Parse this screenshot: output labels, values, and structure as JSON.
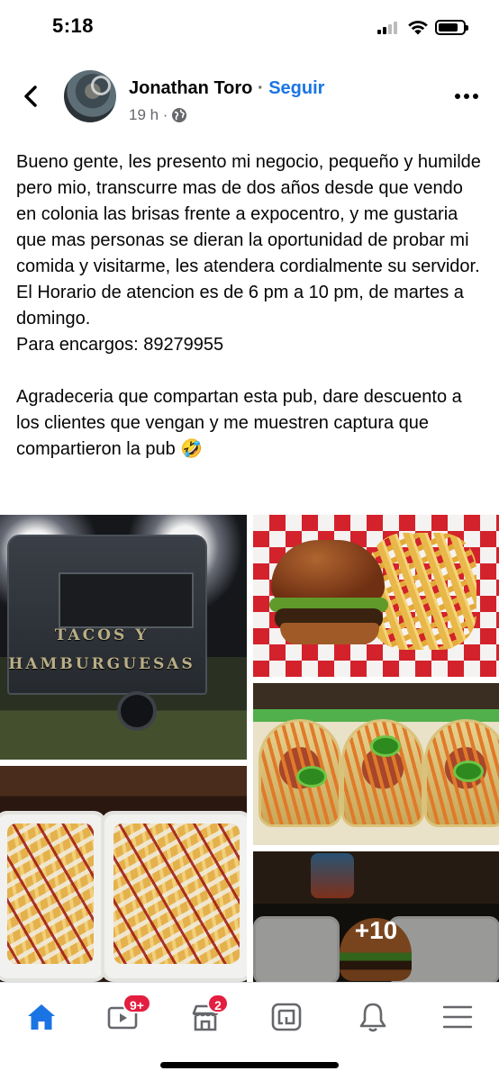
{
  "status_bar": {
    "time": "5:18"
  },
  "post": {
    "author": "Jonathan Toro",
    "separator": "·",
    "follow_label": "Seguir",
    "time_ago": "19 h ·",
    "privacy_icon": "globe-icon",
    "paragraphs": [
      "Bueno gente, les presento mi negocio, pequeño y humilde pero mio, transcurre mas de dos años desde que vendo en colonia las brisas frente a expocentro, y me gustaria que mas personas se dieran la oportunidad de probar mi comida y visitarme, les atendera cordialmente su servidor.\nEl Horario de atencion es de 6 pm a 10 pm, de martes a domingo.\nPara encargos: 89279955",
      "Agradeceria que compartan esta pub, dare descuento a los clientes que vengan y me muestren captura que compartieron la pub 🤣"
    ],
    "photos": {
      "truck_sign_line1": "TACOS Y",
      "truck_sign_line2": "HAMBURGUESAS",
      "more_count": "+10"
    }
  },
  "tab_bar": {
    "tabs": [
      {
        "name": "home",
        "icon": "home-icon",
        "active": true
      },
      {
        "name": "watch",
        "icon": "video-icon",
        "badge": "9+"
      },
      {
        "name": "marketplace",
        "icon": "marketplace-icon",
        "badge": "2"
      },
      {
        "name": "gaming",
        "icon": "gaming-icon"
      },
      {
        "name": "notifications",
        "icon": "bell-icon"
      },
      {
        "name": "menu",
        "icon": "menu-icon"
      }
    ],
    "badges": {
      "watch": "9+",
      "marketplace": "2"
    }
  },
  "colors": {
    "accent": "#1b74e4",
    "badge": "#e41e3f",
    "text": "#050505",
    "secondary_text": "#65676b"
  }
}
